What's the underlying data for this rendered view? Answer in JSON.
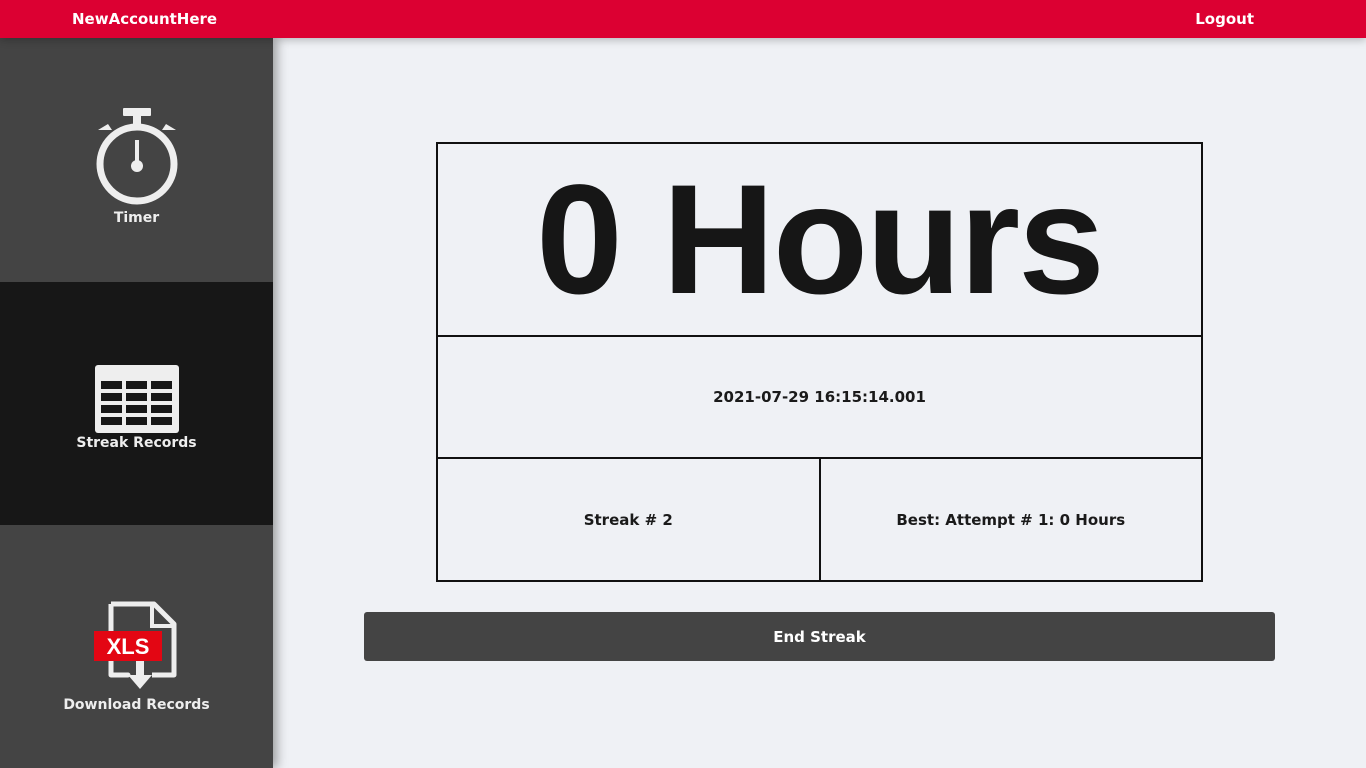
{
  "header": {
    "brand": "NewAccountHere",
    "logout_label": "Logout"
  },
  "sidebar": {
    "items": [
      {
        "label": "Timer",
        "icon": "stopwatch-icon",
        "active": false
      },
      {
        "label": "Streak Records",
        "icon": "table-icon",
        "active": true
      },
      {
        "label": "Download Records",
        "icon": "xls-download-icon",
        "badge": "XLS",
        "active": false
      }
    ]
  },
  "main": {
    "hours": "0 Hours",
    "start_datetime": "2021-07-29 16:15:14.001",
    "streak": "Streak # 2",
    "best": "Best: Attempt # 1: 0 Hours",
    "end_button_label": "End Streak"
  },
  "colors": {
    "topbar": "#dc0032",
    "sidebar": "#444444",
    "sidebar_active": "#171717",
    "background": "#eff1f5",
    "button": "#444444",
    "xls_badge": "#e30613"
  }
}
